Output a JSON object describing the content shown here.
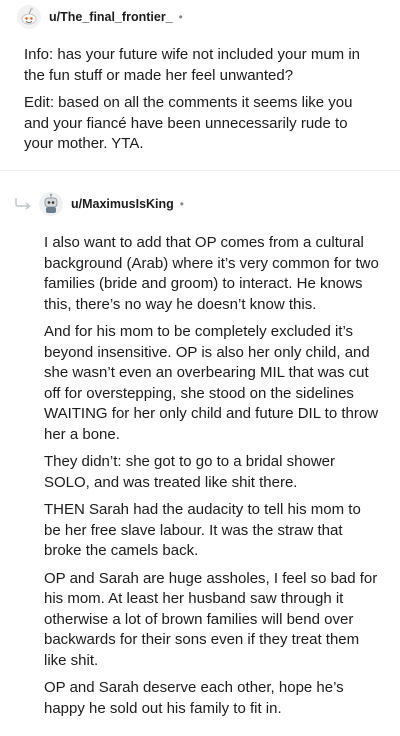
{
  "comment1": {
    "username": "u/The_final_frontier_",
    "separator": "•",
    "avatar_icon": "snoo-avatar-icon",
    "paragraphs": [
      "Info: has your future wife not included your mum in the fun stuff or made her feel unwanted?",
      "Edit: based on all the comments it seems like you and your fiancé have been unnecessarily rude to your mother. YTA."
    ]
  },
  "comment2": {
    "username": "u/MaximusIsKing",
    "separator": "•",
    "avatar_icon": "robot-avatar-icon",
    "reply_icon": "reply-arrow-icon",
    "paragraphs": [
      "I also want to add that OP comes from a cultural background (Arab) where it’s very common for two families (bride and groom) to interact. He knows this, there’s no way he doesn’t know this.",
      "And for his mom to be completely excluded it’s beyond insensitive. OP is also her only child, and she wasn’t even an overbearing MIL that was cut off for overstepping, she stood on the sidelines WAITING for her only child and future DIL to throw her a bone.",
      "They didn’t: she got to go to a bridal shower SOLO, and was treated like shit there.",
      "THEN Sarah had the audacity to tell his mom to be her free slave labour. It was the straw that broke the camels back.",
      "OP and Sarah are huge assholes, I feel so bad for his mom. At least her husband saw through it otherwise a lot of brown families will bend over backwards for their sons even if they treat them like shit.",
      "OP and Sarah deserve each other, hope he’s happy he sold out his family to fit in."
    ]
  }
}
